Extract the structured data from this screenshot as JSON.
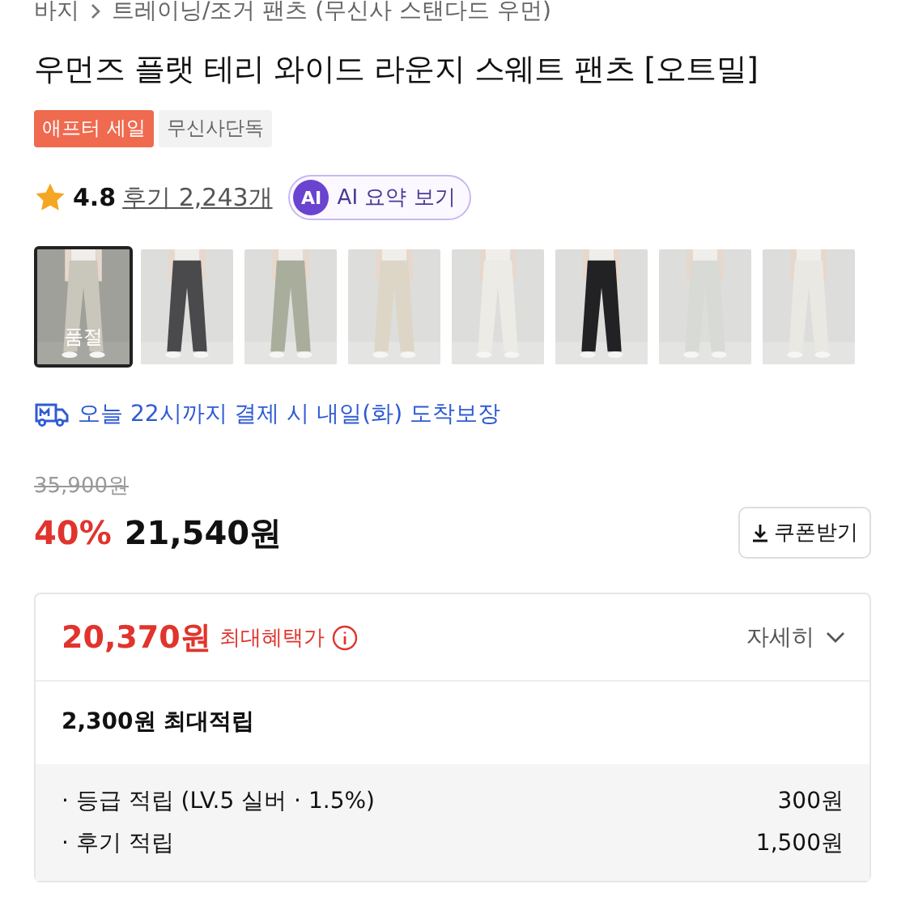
{
  "breadcrumb": [
    {
      "label": "바지"
    },
    {
      "label": "트레이닝/조거 팬츠 (무신사 스탠다드 우먼)"
    }
  ],
  "title": "우먼즈 플랫 테리 와이드 라운지 스웨트 팬츠 [오트밀]",
  "badges": [
    {
      "label": "애프터 세일",
      "kind": "sale"
    },
    {
      "label": "무신사단독",
      "kind": "plain"
    }
  ],
  "rating": {
    "score": "4.8",
    "reviews": "후기 2,243개"
  },
  "ai_button": {
    "icon_label": "AI",
    "label": "AI 요약 보기"
  },
  "thumbnails": [
    {
      "kind": "picture",
      "selected": true,
      "overlay": "품절"
    },
    {
      "kind": "picture",
      "selected": false
    },
    {
      "kind": "picture",
      "selected": false
    },
    {
      "kind": "picture",
      "selected": false
    },
    {
      "kind": "picture",
      "selected": false
    },
    {
      "kind": "picture",
      "selected": false
    },
    {
      "kind": "picture",
      "selected": false
    },
    {
      "kind": "picture",
      "selected": false
    }
  ],
  "delivery": "오늘 22시까지 결제 시 내일(화) 도착보장",
  "price": {
    "original": "35,900원",
    "discount": "40%",
    "current": "21,540원",
    "coupon_button": "쿠폰받기"
  },
  "benefit_card": {
    "max_price": "20,370원",
    "max_label": "최대혜택가",
    "details": "자세히",
    "points_total": "2,300원 최대적립",
    "points": [
      {
        "label": "· 등급 적립 (LV.5 실버 · 1.5%)",
        "value": "300원"
      },
      {
        "label": "· 후기 적립",
        "value": "1,500원"
      }
    ]
  }
}
